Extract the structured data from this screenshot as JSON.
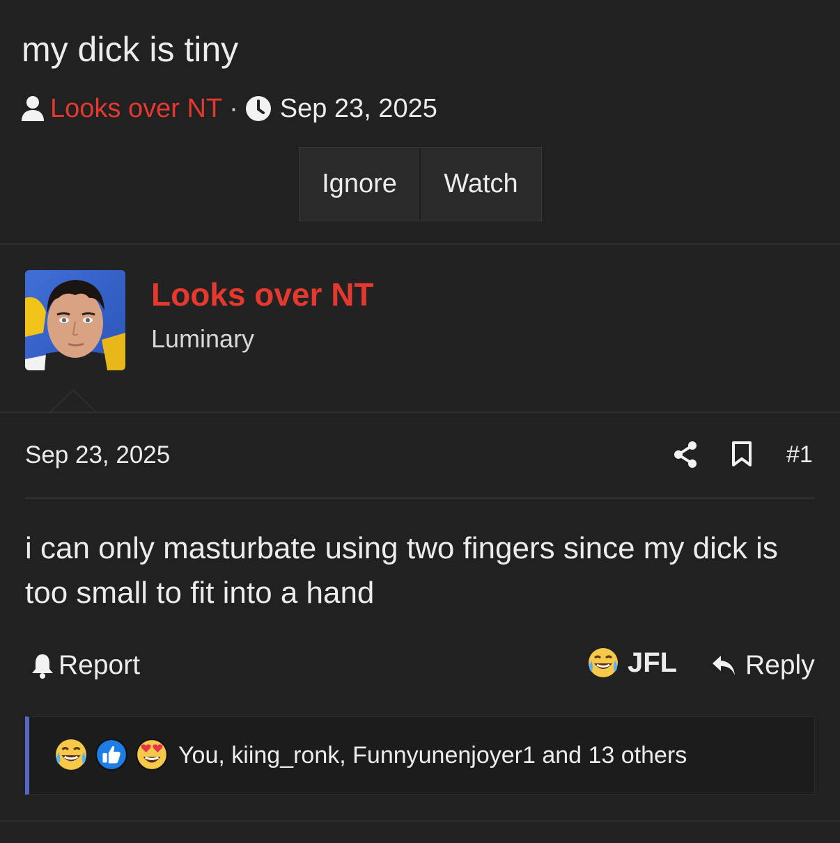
{
  "thread": {
    "title": "my dick is tiny",
    "author": "Looks over NT",
    "separator": "·",
    "date": "Sep 23, 2025",
    "buttons": {
      "ignore": "Ignore",
      "watch": "Watch"
    }
  },
  "post": {
    "username": "Looks over NT",
    "user_title": "Luminary",
    "date": "Sep 23, 2025",
    "number": "#1",
    "body": "i can only masturbate using two fingers since my dick is too small to fit into a hand",
    "actions": {
      "report": "Report",
      "reaction": "JFL",
      "reply": "Reply"
    },
    "reactions_text": "You, kiing_ronk, Funnyunenjoyer1 and 13 others",
    "reaction_icons": [
      "laugh-cry-emoji",
      "thumbs-up-emoji",
      "heart-eyes-emoji"
    ]
  },
  "colors": {
    "background": "#212121",
    "accent_red": "#e5392f",
    "reaction_bar_accent": "#5867c6"
  }
}
